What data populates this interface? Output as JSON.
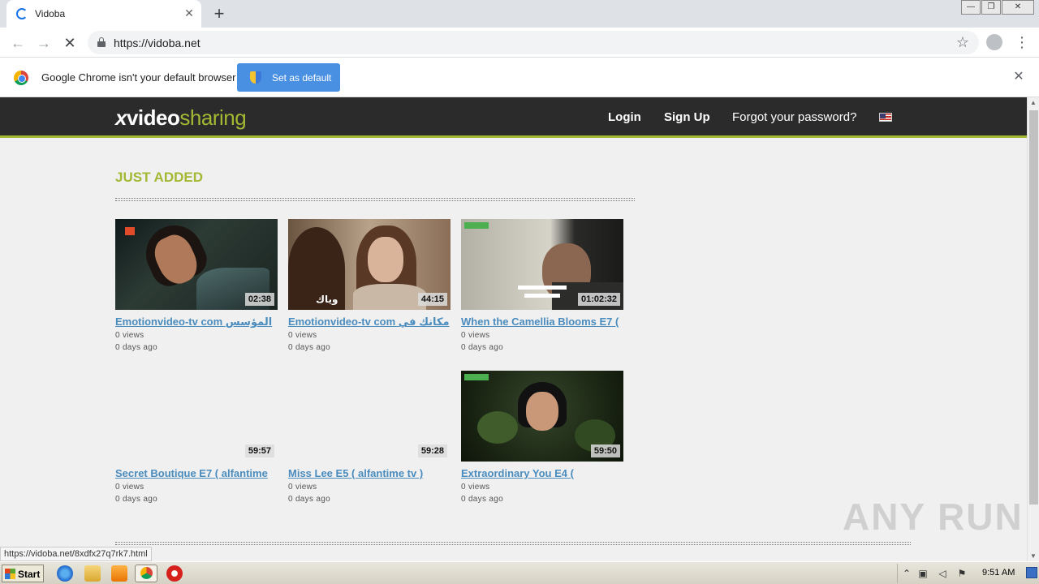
{
  "browser": {
    "tab_title": "Vidoba",
    "tab_close": "✕",
    "new_tab": "+",
    "url": "https://vidoba.net",
    "window_controls": {
      "minimize": "—",
      "restore": "❐",
      "close": "✕"
    }
  },
  "infobar": {
    "message": "Google Chrome isn't your default browser",
    "button": "Set as default",
    "close": "✕"
  },
  "site": {
    "logo": {
      "x": "x",
      "video": "video",
      "sharing": "sharing"
    },
    "nav": {
      "login": "Login",
      "signup": "Sign Up",
      "forgot": "Forgot your password?"
    },
    "section_title": "JUST ADDED",
    "videos": [
      {
        "title": "Emotionvideo-tv com المؤسس",
        "duration": "02:38",
        "views": "0 views",
        "age": "0 days ago"
      },
      {
        "title": "Emotionvideo-tv com مكانك في",
        "duration": "44:15",
        "views": "0 views",
        "age": "0 days ago"
      },
      {
        "title": "When the Camellia Blooms E7 (",
        "duration": "01:02:32",
        "views": "0 views",
        "age": "0 days ago"
      },
      {
        "title": "Secret Boutique E7 ( alfantime",
        "duration": "59:57",
        "views": "0 views",
        "age": "0 days ago"
      },
      {
        "title": "Miss Lee E5 ( alfantime tv )",
        "duration": "59:28",
        "views": "0 views",
        "age": "0 days ago"
      },
      {
        "title": "Extraordinary You E4 (",
        "duration": "59:50",
        "views": "0 views",
        "age": "0 days ago"
      }
    ],
    "thumb2_watermark": "وياك"
  },
  "status_bar_url": "https://vidoba.net/8xdfx27q7rk7.html",
  "watermark": "ANY RUN",
  "taskbar": {
    "start": "Start",
    "clock": "9:51 AM"
  }
}
